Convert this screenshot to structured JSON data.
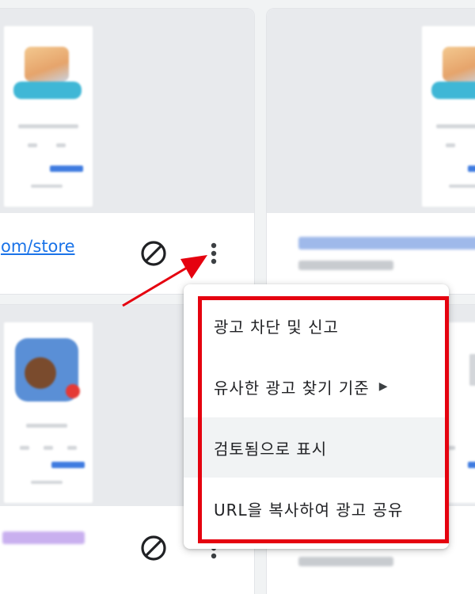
{
  "cards": {
    "top_left": {
      "url_text": "om/store"
    }
  },
  "context_menu": {
    "items": [
      {
        "label": "광고 차단 및 신고"
      },
      {
        "label": "유사한 광고 찾기 기준",
        "submenu_icon": "▶"
      },
      {
        "label": "검토됨으로 표시"
      },
      {
        "label": "URL을 복사하여 광고 공유"
      }
    ]
  },
  "icons": {
    "block": "block-icon",
    "more": "more-vert-icon",
    "submenu": "chevron-right-icon"
  },
  "colors": {
    "highlight_border": "#e5020f",
    "arrow": "#e5020f",
    "link": "#1a73e8",
    "menu_hover": "#f1f3f4"
  }
}
